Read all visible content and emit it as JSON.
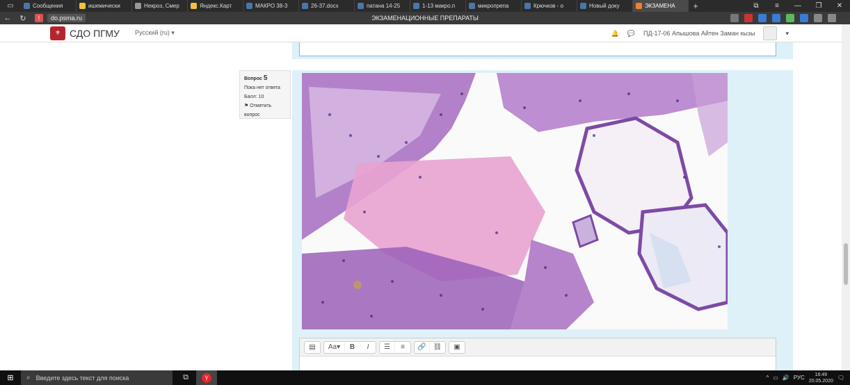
{
  "browser": {
    "tabs": [
      {
        "label": "Сообщения",
        "color": "#4a76a8",
        "active": false
      },
      {
        "label": "ишемически",
        "color": "#f0c040",
        "active": false
      },
      {
        "label": "Некроз, Смер",
        "color": "#999999",
        "active": false
      },
      {
        "label": "Яндекс.Карт",
        "color": "#f0c040",
        "active": false
      },
      {
        "label": "МАКРО 38-3",
        "color": "#4a76a8",
        "active": false
      },
      {
        "label": "26-37.docx",
        "color": "#4a76a8",
        "active": false
      },
      {
        "label": "патана 14-25",
        "color": "#4a76a8",
        "active": false
      },
      {
        "label": "1-13 макро.п",
        "color": "#4a76a8",
        "active": false
      },
      {
        "label": "микропрепа",
        "color": "#4a76a8",
        "active": false
      },
      {
        "label": "Крючков - о",
        "color": "#4a76a8",
        "active": false
      },
      {
        "label": "Новый доку",
        "color": "#4a76a8",
        "active": false
      },
      {
        "label": "ЭКЗАМЕНА",
        "color": "#f08030",
        "active": true
      }
    ],
    "new_tab": "+",
    "url_host": "do.psma.ru",
    "page_title": "ЭКЗАМЕНАЦИОННЫЕ ПРЕПАРАТЫ"
  },
  "site": {
    "brand": "СДО ПГМУ",
    "language": "Русский (ru) ▾",
    "user_name": "ПД-17-06 Апышова Айтен Заман кызы"
  },
  "question": {
    "label": "Вопрос",
    "number": "5",
    "status": "Пока нет ответа",
    "score": "Балл: 10",
    "flag_label": "Отметить вопрос"
  },
  "taskbar": {
    "search_placeholder": "Введите здесь текст для поиска",
    "lang": "РУС",
    "time": "16:49",
    "date": "20.05.2020"
  },
  "colors": {
    "accent": "#b3262c",
    "question_bg": "#def0f8"
  }
}
